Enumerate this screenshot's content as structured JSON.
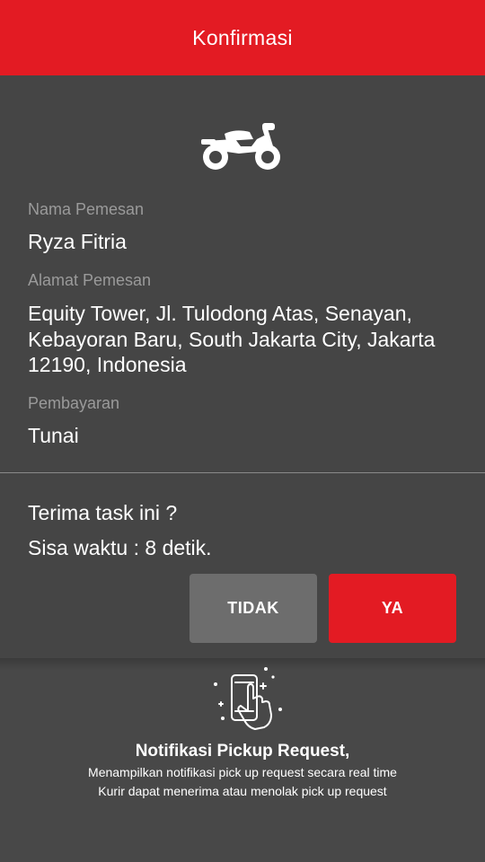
{
  "header": {
    "title": "Konfirmasi"
  },
  "order": {
    "name_label": "Nama Pemesan",
    "name_value": "Ryza Fitria",
    "address_label": "Alamat Pemesan",
    "address_value": "Equity Tower, Jl. Tulodong Atas, Senayan, Kebayoran Baru, South Jakarta City, Jakarta 12190, Indonesia",
    "payment_label": "Pembayaran",
    "payment_value": "Tunai"
  },
  "confirm": {
    "question": "Terima task ini ?",
    "countdown": "Sisa waktu : 8 detik.",
    "no_label": "TIDAK",
    "yes_label": "YA"
  },
  "promo": {
    "title": "Notifikasi Pickup Request,",
    "line1": "Menampilkan notifikasi pick up request secara real time",
    "line2": "Kurir dapat menerima atau menolak pick up request"
  },
  "icons": {
    "vehicle": "motorcycle-icon",
    "promo": "phone-tap-icon"
  },
  "colors": {
    "accent": "#e31b23",
    "background": "#484848",
    "button_secondary": "#6d6d6d"
  }
}
